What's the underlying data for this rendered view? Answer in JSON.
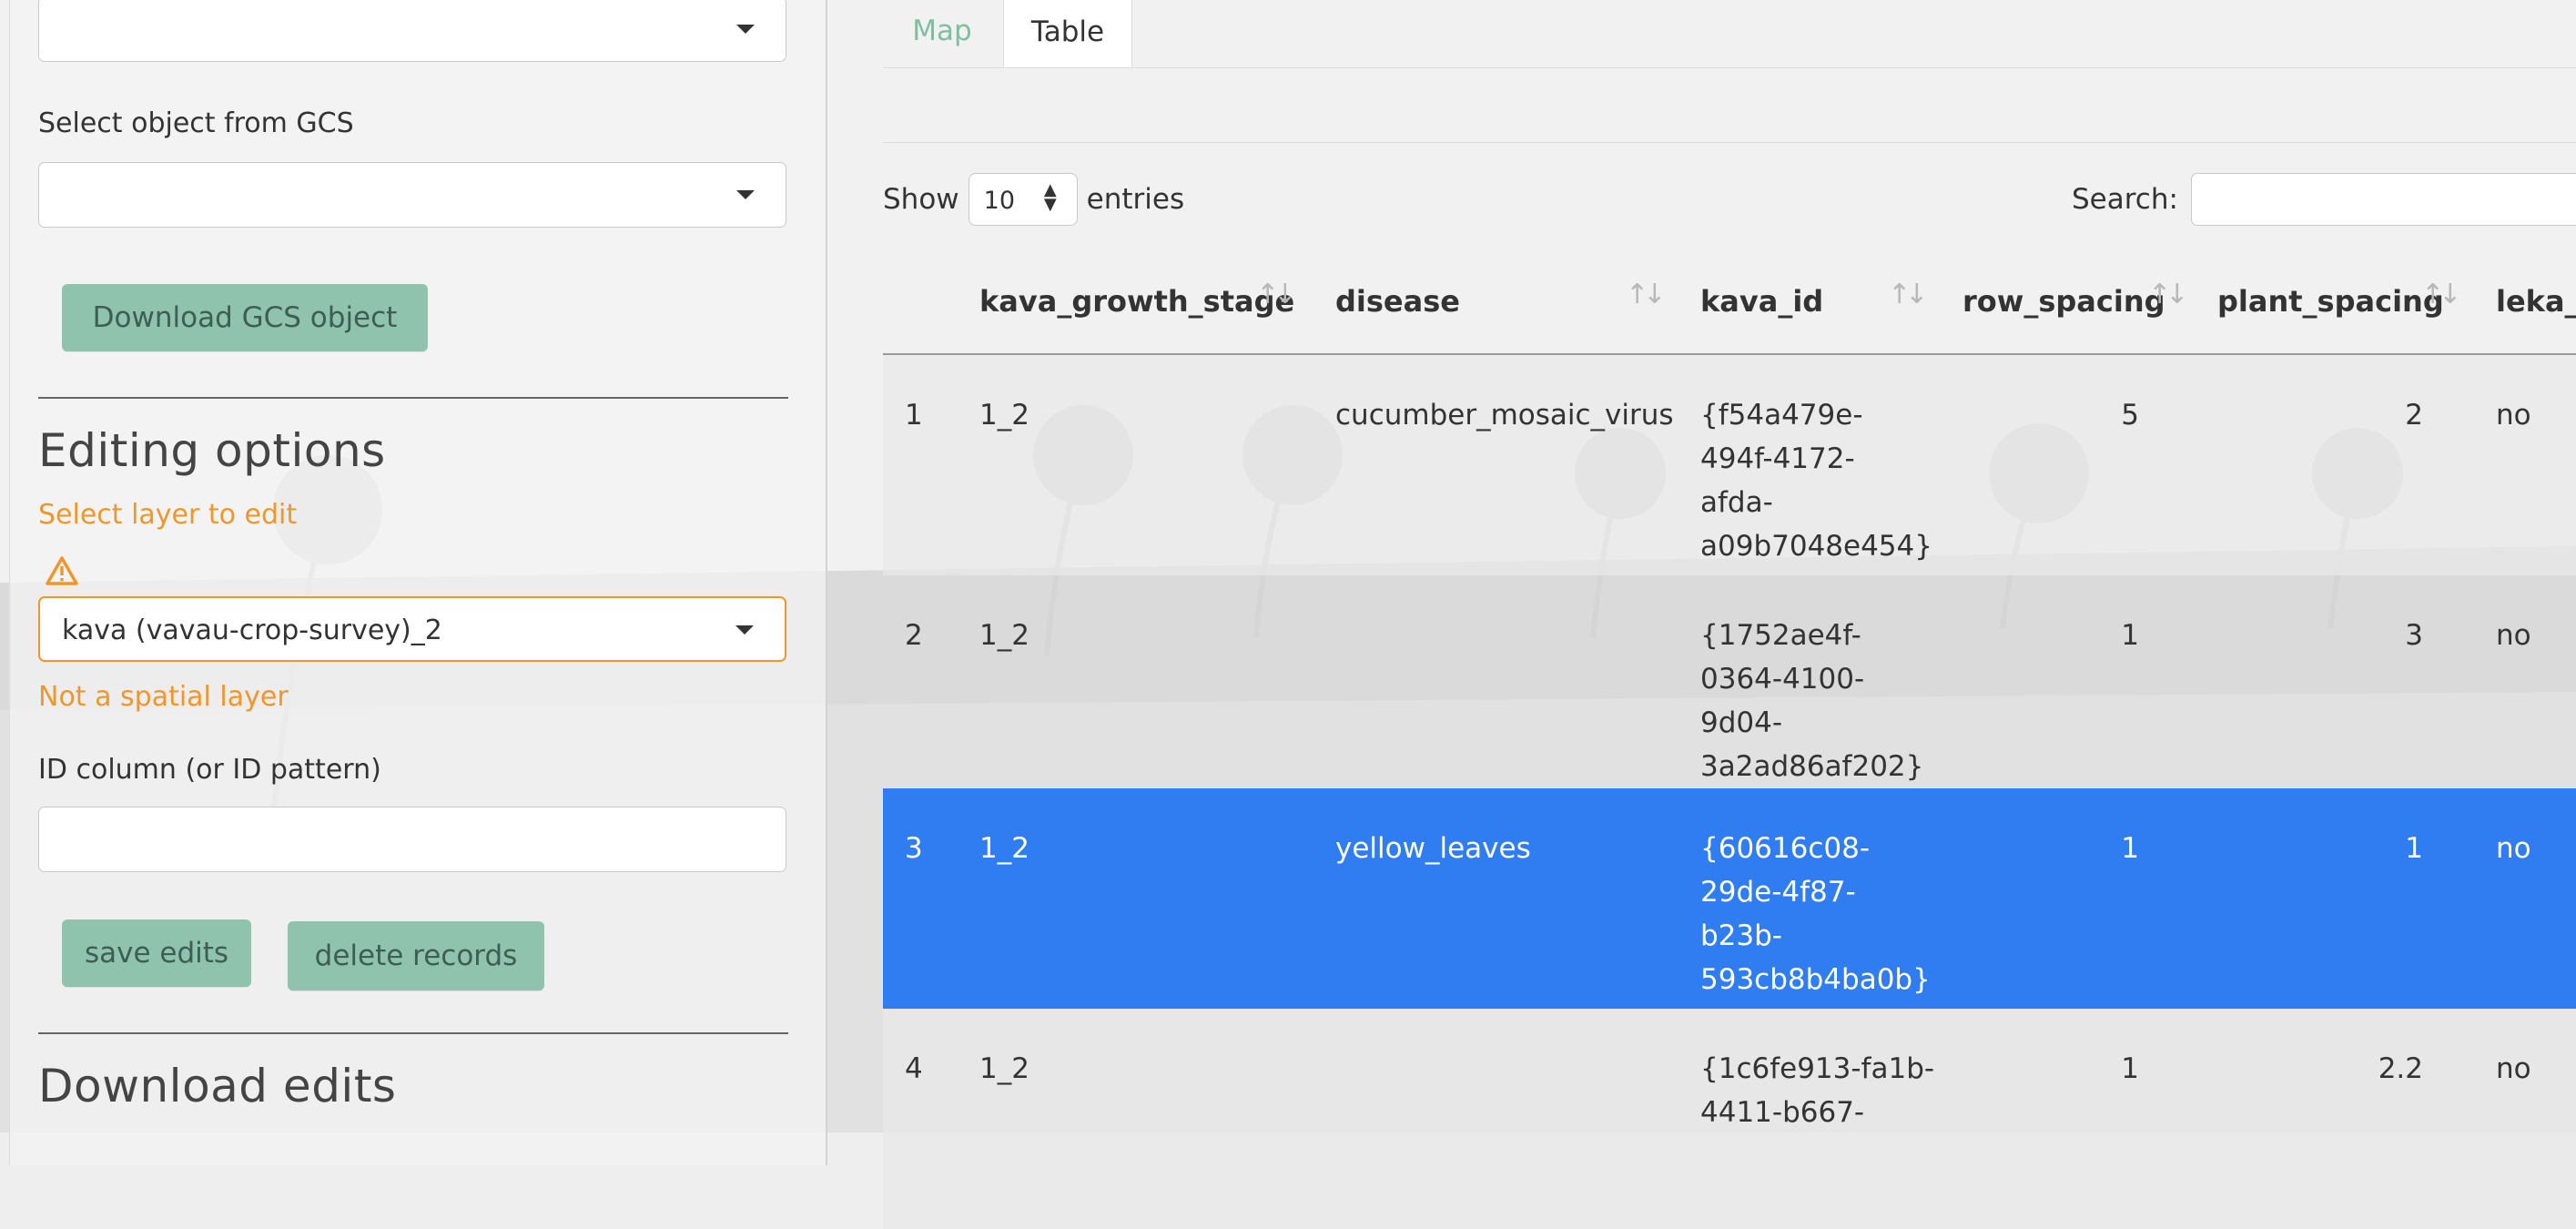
{
  "sidebar": {
    "gcs_object_label": "Select object from GCS",
    "download_gcs_button": "Download GCS object",
    "editing_heading": "Editing options",
    "select_layer_label": "Select layer to edit",
    "layer_value": "kava (vavau-crop-survey)_2",
    "layer_warning": "Not a spatial layer",
    "id_column_label": "ID column (or ID pattern)",
    "save_button": "save edits",
    "delete_button": "delete records",
    "download_heading": "Download edits"
  },
  "tabs": {
    "map": "Map",
    "table": "Table"
  },
  "table_controls": {
    "show_label": "Show",
    "page_length": "10",
    "entries_label": "entries",
    "search_label": "Search:"
  },
  "table": {
    "columns": [
      "kava_growth_stage",
      "disease",
      "kava_id",
      "row_spacing",
      "plant_spacing",
      "leka_l"
    ],
    "rows": [
      {
        "idx": "1",
        "stage": "1_2",
        "disease": "cucumber_mosaic_virus",
        "kava_id": [
          "{f54a479e-",
          "494f-4172-",
          "afda-",
          "a09b7048e454}"
        ],
        "row_spacing": "5",
        "plant_spacing": "2",
        "leka": "no"
      },
      {
        "idx": "2",
        "stage": "1_2",
        "disease": "",
        "kava_id": [
          "{1752ae4f-",
          "0364-4100-",
          "9d04-",
          "3a2ad86af202}"
        ],
        "row_spacing": "1",
        "plant_spacing": "3",
        "leka": "no"
      },
      {
        "idx": "3",
        "stage": "1_2",
        "disease": "yellow_leaves",
        "kava_id": [
          "{60616c08-",
          "29de-4f87-",
          "b23b-",
          "593cb8b4ba0b}"
        ],
        "row_spacing": "1",
        "plant_spacing": "1",
        "leka": "no"
      },
      {
        "idx": "4",
        "stage": "1_2",
        "disease": "",
        "kava_id": [
          "{1c6fe913-fa1b-",
          "4411-b667-"
        ],
        "row_spacing": "1",
        "plant_spacing": "2.2",
        "leka": "no"
      }
    ]
  },
  "colors": {
    "accent_button": "#8fc3ad",
    "selected_row": "#2f7df0",
    "warning": "#f0962b",
    "active_tab_text": "#7dbfa0"
  },
  "icons": {
    "warning": "warning-triangle-icon",
    "caret": "chevron-down-icon",
    "sort": "sort-arrows-icon"
  }
}
